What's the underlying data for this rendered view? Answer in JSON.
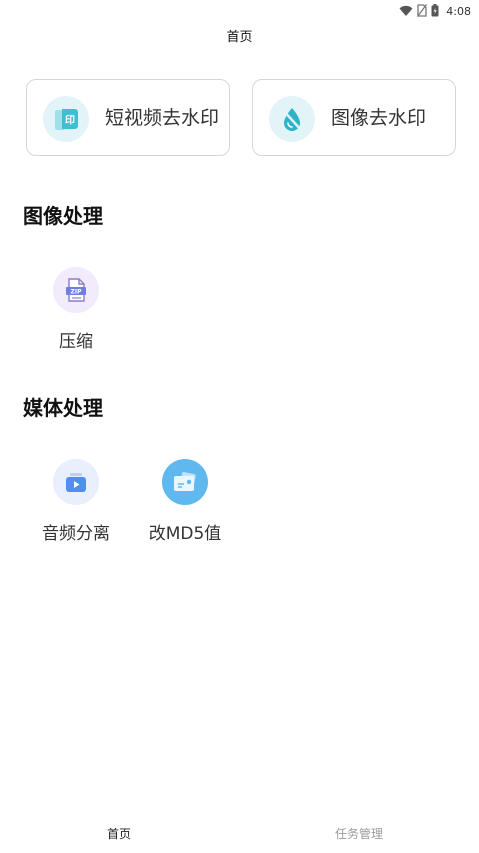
{
  "status_bar": {
    "time": "4:08",
    "icons": [
      "wifi-icon",
      "no-sim-icon",
      "battery-icon"
    ]
  },
  "header": {
    "title": "首页"
  },
  "quick_actions": [
    {
      "label": "短视频去水印",
      "icon": "video-watermark-icon"
    },
    {
      "label": "图像去水印",
      "icon": "image-watermark-icon"
    }
  ],
  "sections": [
    {
      "title": "图像处理",
      "tools": [
        {
          "label": "压缩",
          "icon": "zip-icon"
        }
      ]
    },
    {
      "title": "媒体处理",
      "tools": [
        {
          "label": "音频分离",
          "icon": "audio-separate-icon"
        },
        {
          "label": "改MD5值",
          "icon": "md5-card-icon"
        }
      ]
    }
  ],
  "bottom_nav": [
    {
      "label": "首页",
      "active": true
    },
    {
      "label": "任务管理",
      "active": false
    }
  ],
  "colors": {
    "accent_blue": "#5fb8ee",
    "icon_circle_teal": "#e2f4f8",
    "icon_circle_purple": "#f1ebfb",
    "icon_circle_blue": "#e7f0fc",
    "inactive_text": "#9a9a9a"
  }
}
